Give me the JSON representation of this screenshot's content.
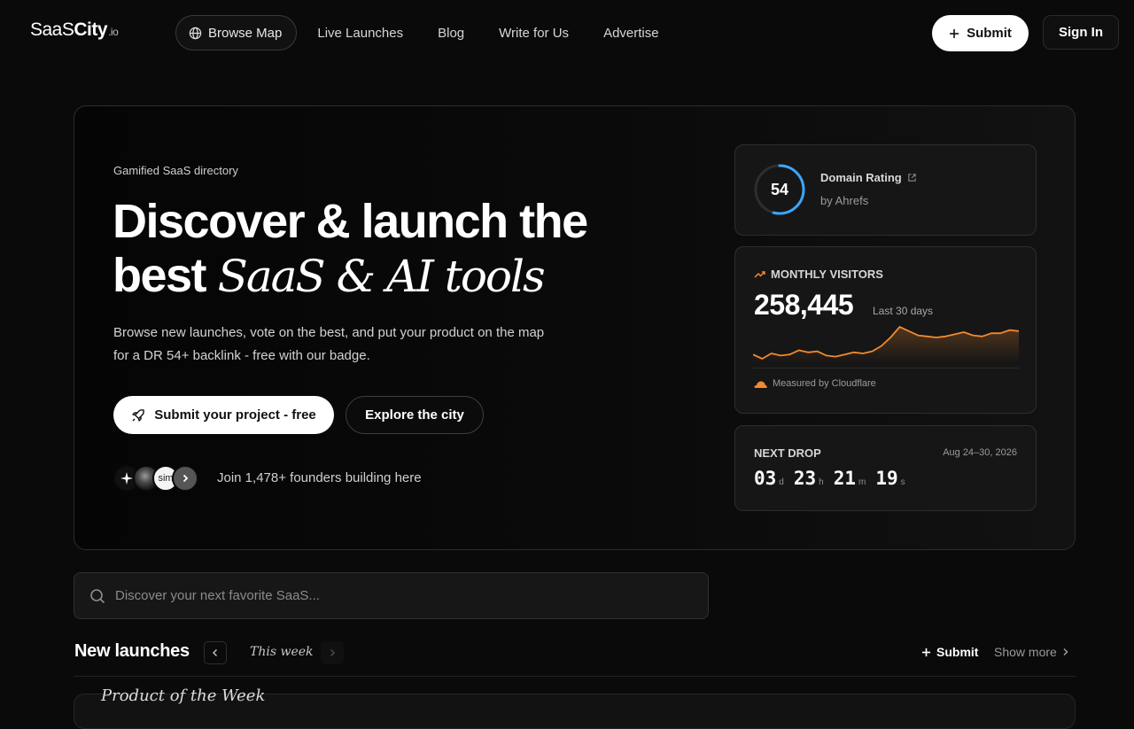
{
  "nav": {
    "logo_main": "SaaS",
    "logo_bold": "City",
    "logo_tld": ".io",
    "browse_map": "Browse Map",
    "links": [
      "Live Launches",
      "Blog",
      "Write for Us",
      "Advertise"
    ],
    "submit": "Submit",
    "sign_in": "Sign In"
  },
  "hero": {
    "eyebrow": "Gamified SaaS directory",
    "headline_line1": "Discover & launch the",
    "headline_bold2": "best",
    "headline_italic": "SaaS & AI tools",
    "lead": "Browse new launches, vote on the best, and put your product on the map for a DR 54+ backlink - free with our badge.",
    "cta_primary": "Submit your project - free",
    "cta_secondary": "Explore the city",
    "avatar_text": "sim",
    "founders": "Join 1,478+ founders building here"
  },
  "domain_rating": {
    "value": "54",
    "progress": 0.54,
    "title": "Domain Rating",
    "by": "by Ahrefs",
    "accent": "#3aa6ff"
  },
  "monthly_visitors": {
    "label": "MONTHLY VISITORS",
    "value": "258,445",
    "period": "Last 30 days",
    "footer": "Measured by Cloudflare",
    "accent": "#f28a2e",
    "trend": [
      30,
      26,
      31,
      29,
      30,
      34,
      32,
      33,
      29,
      28,
      30,
      32,
      31,
      33,
      38,
      46,
      56,
      52,
      48,
      47,
      46,
      47,
      49,
      51,
      48,
      47,
      50,
      50,
      53,
      52
    ]
  },
  "next_drop": {
    "label": "NEXT DROP",
    "date_range": "Aug 24–30, 2026",
    "days": "03",
    "days_unit": "d",
    "hours": "23",
    "hours_unit": "h",
    "minutes": "21",
    "minutes_unit": "m",
    "seconds": "19",
    "seconds_unit": "s"
  },
  "search": {
    "placeholder": "Discover your next favorite SaaS..."
  },
  "new_launches": {
    "title": "New launches",
    "week": "This week",
    "submit": "Submit",
    "show_more": "Show more",
    "product_of_week": "Product of the Week"
  }
}
